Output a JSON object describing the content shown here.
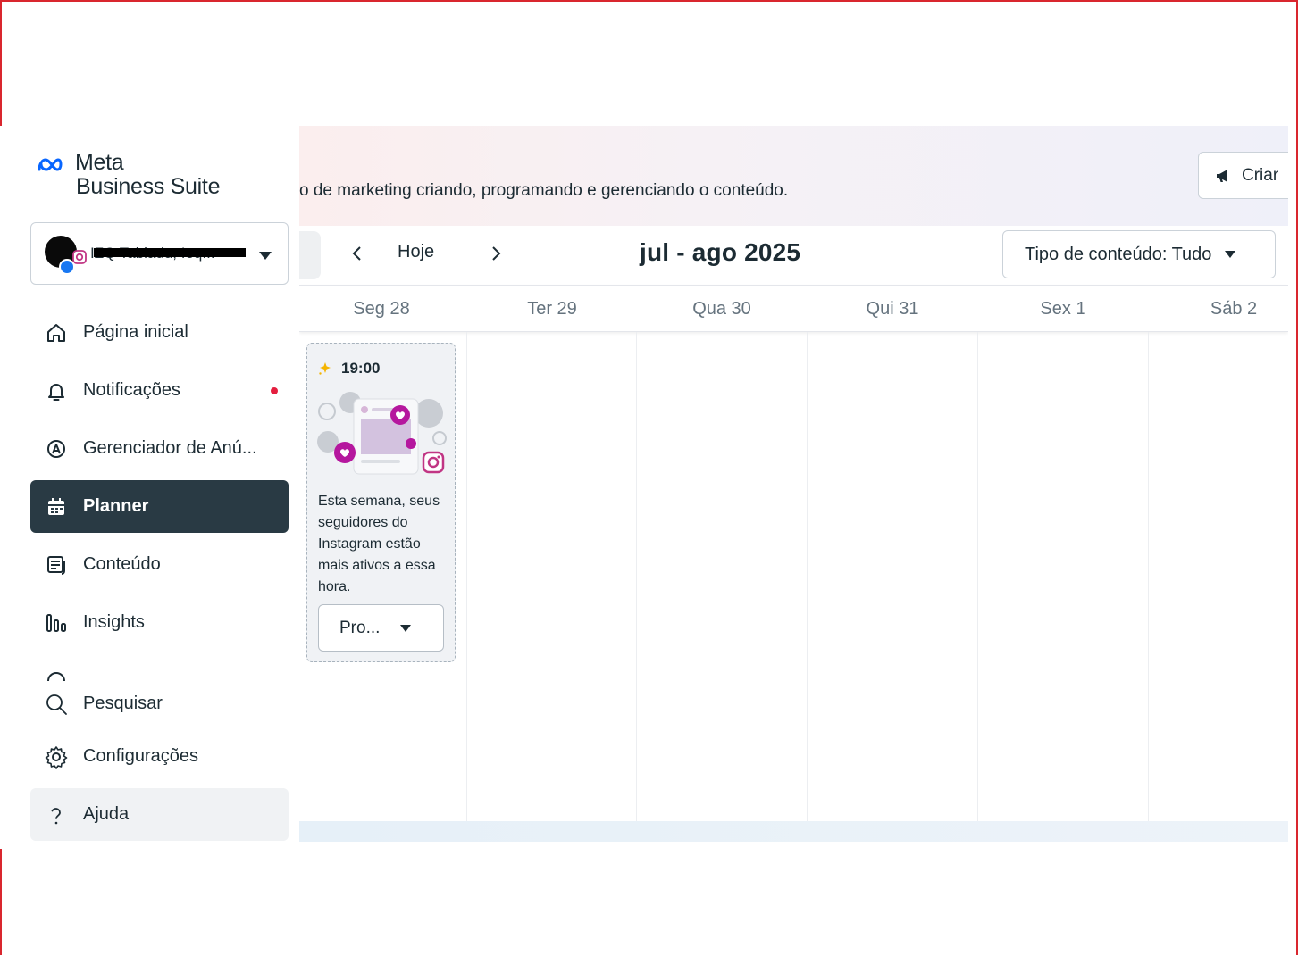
{
  "brand": {
    "line1": "Meta",
    "line2": "Business Suite"
  },
  "account": {
    "name": "IZQ Tabladu, Ieq..."
  },
  "sidebar": {
    "items": [
      {
        "label": "Página inicial"
      },
      {
        "label": "Notificações",
        "unread": true
      },
      {
        "label": "Gerenciador de Anú..."
      },
      {
        "label": "Planner",
        "active": true
      },
      {
        "label": "Conteúdo"
      },
      {
        "label": "Insights"
      }
    ],
    "bottom": [
      {
        "label": "Pesquisar"
      },
      {
        "label": "Configurações"
      },
      {
        "label": "Ajuda"
      }
    ]
  },
  "header": {
    "description": "o de marketing criando, programando e gerenciando o conteúdo.",
    "create_label": "Criar"
  },
  "toolbar": {
    "today_label": "Hoje",
    "range_title": "jul - ago 2025",
    "content_type_filter": "Tipo de conteúdo: Tudo"
  },
  "days": [
    "Seg 28",
    "Ter 29",
    "Qua 30",
    "Qui 31",
    "Sex 1",
    "Sáb 2"
  ],
  "suggestion": {
    "time": "19:00",
    "text": "Esta semana, seus seguidores do Instagram estão mais ativos a essa hora.",
    "button_label": "Pro..."
  },
  "colors": {
    "active_nav_bg": "#293a44",
    "notification_dot": "#e41e3f",
    "instagram_accent": "#c13584",
    "border": "#cbd2d9"
  }
}
